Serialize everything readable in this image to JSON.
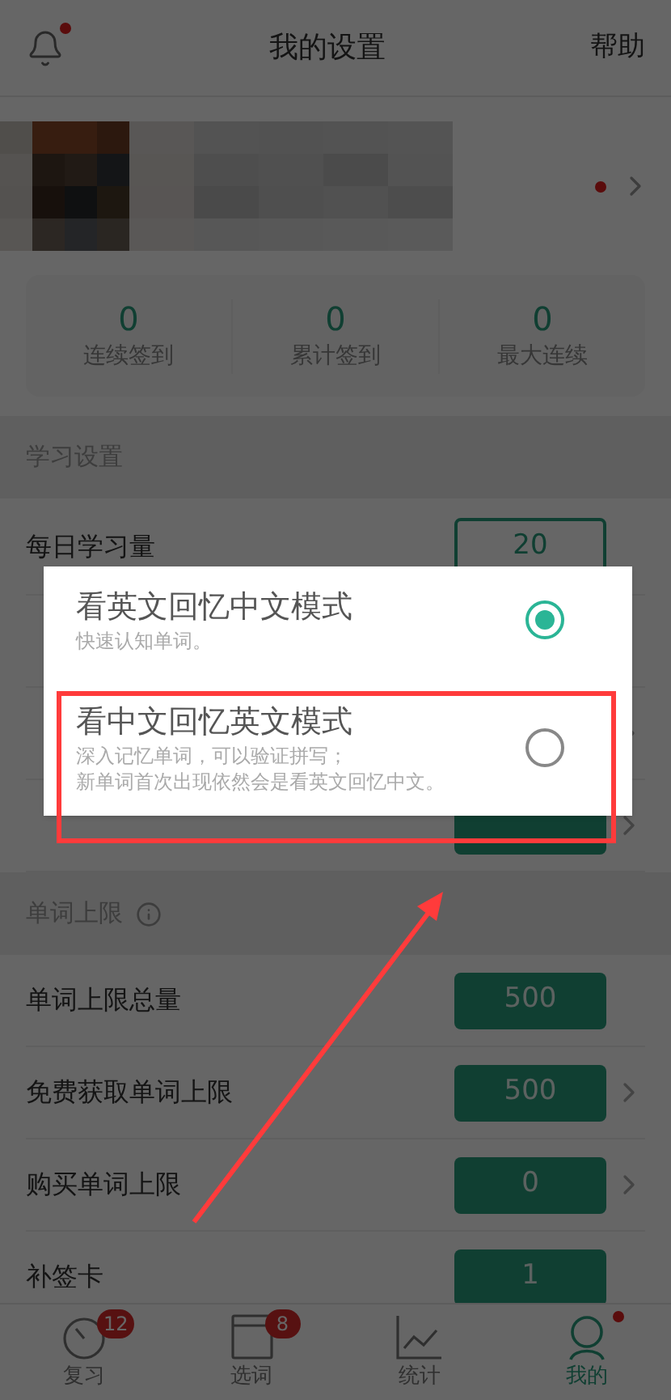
{
  "header": {
    "title": "我的设置",
    "help": "帮助",
    "bell_dot": true
  },
  "profile": {
    "kind": "picture",
    "dot": true
  },
  "stats": [
    {
      "value": "0",
      "label": "连续签到"
    },
    {
      "value": "0",
      "label": "累计签到"
    },
    {
      "value": "0",
      "label": "最大连续"
    }
  ],
  "sections": [
    {
      "title": "学习设置",
      "info": false,
      "rows": [
        {
          "label": "每日学习量",
          "value": "20",
          "kind": "outlined",
          "chevron": false
        },
        {
          "kind": "none",
          "chevron": false
        },
        {
          "kind": "none",
          "chevron": true
        },
        {
          "kind": "filled",
          "chevron": true
        }
      ]
    },
    {
      "title": "单词上限",
      "info": true,
      "rows": [
        {
          "label": "单词上限总量",
          "value": "500",
          "kind": "filled",
          "chevron": false
        },
        {
          "label": "免费获取单词上限",
          "value": "500",
          "kind": "filled",
          "chevron": true
        },
        {
          "label": "购买单词上限",
          "value": "0",
          "kind": "filled",
          "chevron": true
        },
        {
          "label": "补签卡",
          "value": "1",
          "kind": "filled",
          "chevron": false
        }
      ]
    }
  ],
  "dialog": {
    "options": [
      {
        "title": "看英文回忆中文模式",
        "desc": [
          "快速认知单词。"
        ],
        "selected": true
      },
      {
        "title": "看中文回忆英文模式",
        "desc": [
          "深入记忆单词，可以验证拼写；",
          "新单词首次出现依然会是看英文回忆中文。"
        ],
        "selected": false
      }
    ]
  },
  "nav": [
    {
      "label": "复习",
      "kind": "timer",
      "badge": "12",
      "selected": false,
      "dot": false
    },
    {
      "label": "选词",
      "kind": "notebook",
      "badge": "8",
      "selected": false,
      "dot": false
    },
    {
      "label": "统计",
      "kind": "chart",
      "selected": false,
      "dot": false
    },
    {
      "label": "我的",
      "kind": "user",
      "selected": true,
      "dot": true
    }
  ]
}
